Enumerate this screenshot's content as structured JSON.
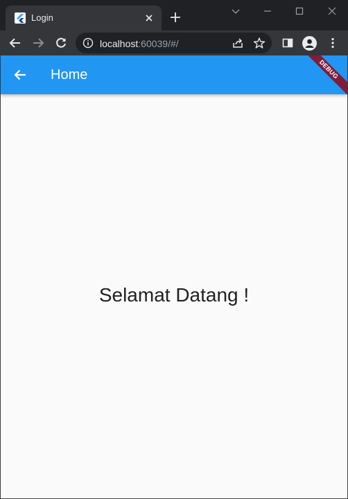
{
  "browser": {
    "tab": {
      "title": "Login",
      "favicon": "flutter-icon"
    },
    "url": {
      "host": "localhost",
      "rest": ":60039/#/"
    },
    "icons": {
      "back": "back-arrow-icon",
      "forward": "forward-arrow-icon",
      "reload": "reload-icon",
      "info": "info-icon",
      "share": "share-icon",
      "bookmark": "star-icon",
      "side_panel": "side-panel-icon",
      "profile": "profile-icon",
      "menu": "kebab-menu-icon"
    },
    "colors": {
      "frame": "#202124",
      "toolbar": "#35363a",
      "omnibox": "#202124"
    }
  },
  "app": {
    "appbar": {
      "title": "Home",
      "back_icon": "back-arrow-icon",
      "color": "#2196f3"
    },
    "debug_banner": "DEBUG",
    "body": {
      "message": "Selamat Datang !",
      "background": "#fafafa"
    }
  }
}
